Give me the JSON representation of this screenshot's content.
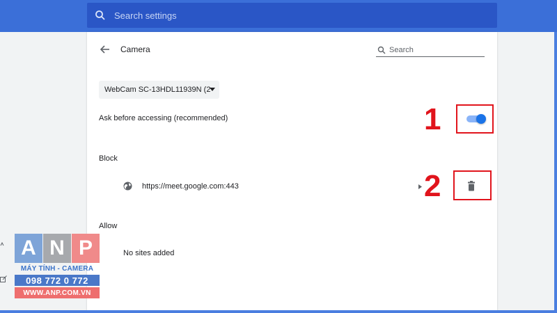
{
  "header": {
    "search_placeholder": "Search settings"
  },
  "page": {
    "title": "Camera",
    "search_placeholder": "Search"
  },
  "camera": {
    "selected_device": "WebCam SC-13HDL11939N (2",
    "ask_label": "Ask before accessing (recommended)",
    "ask_enabled": true
  },
  "block": {
    "heading": "Block",
    "sites": [
      {
        "url": "https://meet.google.com:443"
      }
    ]
  },
  "allow": {
    "heading": "Allow",
    "empty_text": "No sites added"
  },
  "annotations": {
    "one": "1",
    "two": "2"
  },
  "logo": {
    "letters": [
      "A",
      "N",
      "P"
    ],
    "tagline": "MÁY TÍNH - CAMERA",
    "phone": "098 772 0 772",
    "website": "WWW.ANP.COM.VN"
  },
  "colors": {
    "header_blue": "#3b6fd8",
    "header_search_bg": "#2a56c6",
    "toggle_on": "#1a73e8",
    "annotation_red": "#e1141c"
  }
}
